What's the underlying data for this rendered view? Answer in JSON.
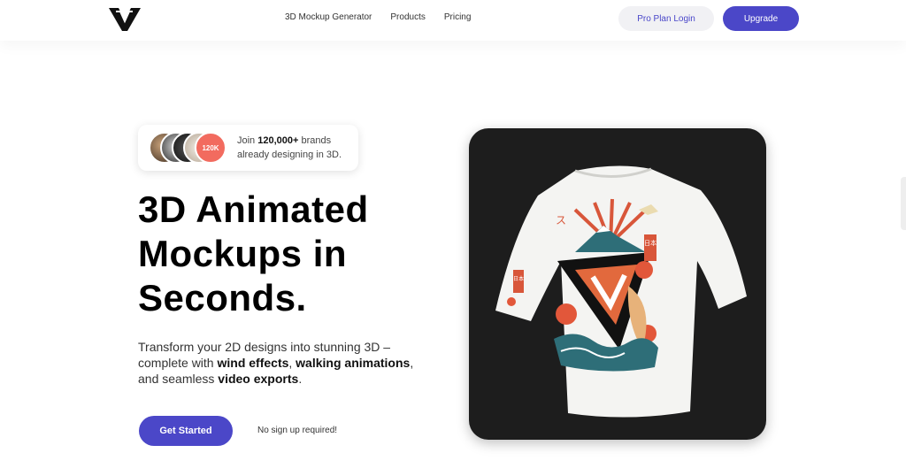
{
  "nav": {
    "items": [
      {
        "label": "3D Mockup Generator"
      },
      {
        "label": "Products"
      },
      {
        "label": "Pricing"
      }
    ],
    "pro_login": "Pro Plan Login",
    "upgrade": "Upgrade"
  },
  "proof": {
    "badge": "120K",
    "line1_prefix": "Join ",
    "line1_bold": "120,000+",
    "line1_suffix": " brands",
    "line2": "already designing in 3D."
  },
  "hero": {
    "title_lines": [
      "3D Animated",
      "Mockups in",
      "Seconds."
    ],
    "desc_1": "Transform your 2D designs into stunning 3D – complete with ",
    "desc_bold_1": "wind effects",
    "desc_2": ", ",
    "desc_bold_2": "walking animations",
    "desc_3": ", and seamless ",
    "desc_bold_3": "video exports",
    "desc_4": ".",
    "cta": "Get Started",
    "note": "No sign up required!"
  },
  "mockup": {
    "shirt_text_left": "ス",
    "shirt_text_right": "日本",
    "sleeve_text": "日本"
  },
  "colors": {
    "accent": "#4b47c8",
    "badge": "#f26b5f",
    "mockup_bg": "#1d1d1d"
  }
}
